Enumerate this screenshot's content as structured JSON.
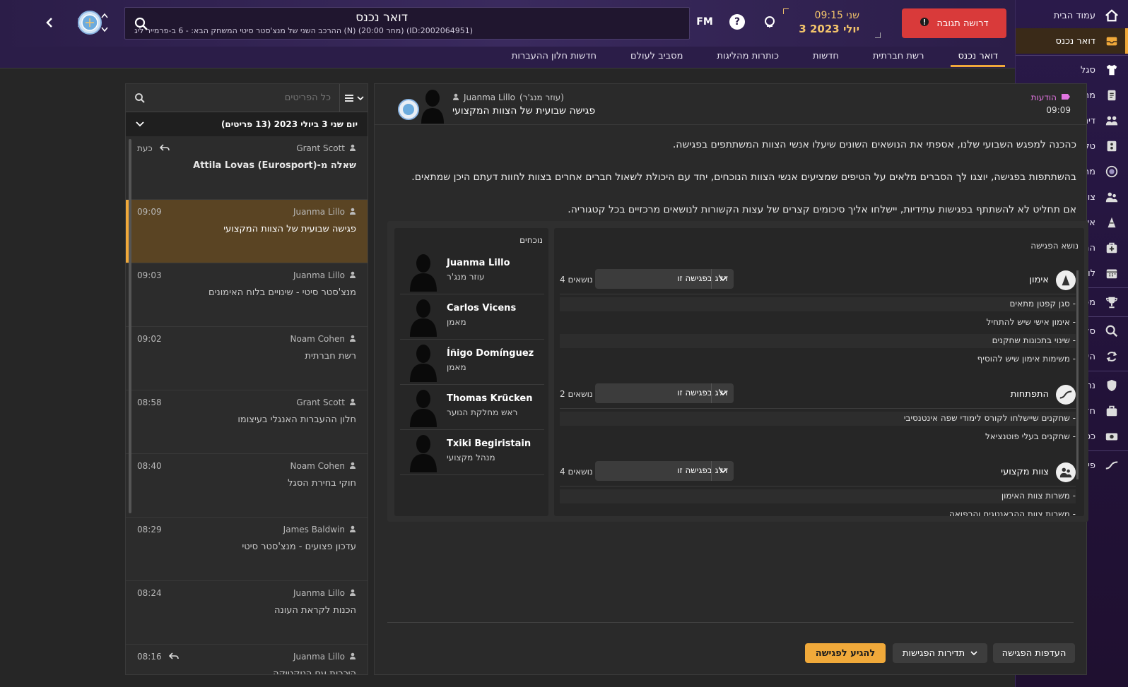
{
  "sidebar": {
    "items": [
      {
        "label": "עמוד הבית",
        "icon": "home-icon"
      },
      {
        "label": "דואר נכנס",
        "icon": "inbox-icon",
        "active": true
      },
      {
        "label": "סגל",
        "icon": "shirt-icon"
      },
      {
        "label": "מתכנן הסגל",
        "icon": "clipboard-icon"
      },
      {
        "label": "דינמיקה קבוצתית",
        "icon": "group-dynamics-icon"
      },
      {
        "label": "טקטיקה",
        "icon": "tactics-icon"
      },
      {
        "label": "מרכז הנתונים",
        "icon": "data-hub-icon"
      },
      {
        "label": "צוות מקצועי",
        "icon": "staff-icon"
      },
      {
        "label": "אימונים",
        "icon": "training-cone-icon"
      },
      {
        "label": "המרכז הרפואי",
        "icon": "medical-icon"
      },
      {
        "label": "לוח זמנים",
        "icon": "calendar-icon"
      },
      {
        "label": "מפעלים",
        "icon": "trophy-icon"
      },
      {
        "label": "סקאוטינג",
        "icon": "magnifier-icon"
      },
      {
        "label": "העברות",
        "icon": "transfers-icon"
      },
      {
        "label": "נתוני המועדון",
        "icon": "shield-icon"
      },
      {
        "label": "חזון המועדון",
        "icon": "briefcase-icon"
      },
      {
        "label": "כספים",
        "icon": "money-icon"
      },
      {
        "label": "פיתוח כשרונות",
        "icon": "development-icon"
      }
    ]
  },
  "header": {
    "title": "דואר נכנס",
    "subtitle": "ההרכב השני של מנצ'סטר סיטי המשחק הבא: - 6 ב-פרמייר ליג (N) (20:00 מחר) (ID:2002064951)",
    "fm_label": "FM",
    "time": "09:15 שני",
    "date": "3 יולי 2023",
    "response_button": "דרושה תגובה"
  },
  "tabs": [
    {
      "label": "דואר נכנס",
      "active": true
    },
    {
      "label": "רשת חברתית"
    },
    {
      "label": "חדשות"
    },
    {
      "label": "כותרות מהליגות"
    },
    {
      "label": "מסביב לעולם"
    },
    {
      "label": "חדשות חלון ההעברות"
    }
  ],
  "list": {
    "search_placeholder": "כל הפריטים",
    "group_label": "יום שני 3 ביולי 2023 (13 פריטים)",
    "messages": [
      {
        "sender": "Grant Scott",
        "time": "כעת",
        "subject": "שאלה מ-Attila Lovas (Eurosport)",
        "bold": true,
        "replied": true
      },
      {
        "sender": "Juanma Lillo",
        "time": "09:09",
        "subject": "פגישה שבועית של הצוות המקצועי",
        "selected": true
      },
      {
        "sender": "Juanma Lillo",
        "time": "09:03",
        "subject": "מנצ'סטר סיטי - שינויים בלוח האימונים"
      },
      {
        "sender": "Noam Cohen",
        "time": "09:02",
        "subject": "רשת חברתית"
      },
      {
        "sender": "Grant Scott",
        "time": "08:58",
        "subject": "חלון ההעברות האנגלי בעיצומו"
      },
      {
        "sender": "Noam Cohen",
        "time": "08:40",
        "subject": "חוקי בחירת הסגל"
      },
      {
        "sender": "James Baldwin",
        "time": "08:29",
        "subject": "עדכון פצועים - מנצ'סטר סיטי"
      },
      {
        "sender": "Juanma Lillo",
        "time": "08:24",
        "subject": "הכנות לקראת העונה"
      },
      {
        "sender": "Juanma Lillo",
        "time": "08:16",
        "subject": "היכרות עם הטקטיקה",
        "replied": true
      }
    ]
  },
  "message": {
    "category": "הודעות",
    "time": "09:09",
    "from_name": "Juanma Lillo",
    "from_role": "(עוזר מנג'ר)",
    "subject": "פגישה שבועית של הצוות המקצועי",
    "paragraphs": [
      "כהכנה למפגש השבועי שלנו, אספתי את הנושאים השונים שיעלו אנשי הצוות המשתתפים בפגישה.",
      "בהשתתפות בפגישה, יוצגו לך הסברים מלאים על הטיפים שמציעים אנשי הצוות הנוכחים, יחד עם היכולת לשאול חברים אחרים בצוות לחוות דעתם היכן שמתאים.",
      "אם תחליט לא להשתתף בפגישות עתידיות, יישלחו אליך סיכומים קצרים של עצות הקשורות לנושאים מרכזיים בכל קטגוריה."
    ],
    "attendees_title": "נוכחים",
    "attendees": [
      {
        "name": "Juanma Lillo",
        "role": "עוזר מנג'ר"
      },
      {
        "name": "Carlos Vicens",
        "role": "מאמן"
      },
      {
        "name": "Íñigo Domínguez",
        "role": "מאמן"
      },
      {
        "name": "Thomas Krücken",
        "role": "ראש מחלקת הנוער"
      },
      {
        "name": "Txiki Begiristain",
        "role": "מנהל מקצועי"
      }
    ],
    "topics_title": "נושא הפגישה",
    "topics": [
      {
        "name": "אימון",
        "count": "4 נושאים",
        "select": "דלג בפגישה זו",
        "icon": "training-cone-icon",
        "items": [
          "סגן קפטן מתאים -",
          "אימון אישי שיש להתחיל -",
          "שינוי בתכונות שחקנים -",
          "משימות אימון שיש להוסיף -"
        ]
      },
      {
        "name": "התפתחות",
        "count": "2 נושאים",
        "select": "דלג בפגישה זו",
        "icon": "development-icon",
        "items": [
          "שחקנים שיישלחו לקורס לימודי שפה אינטנסיבי -",
          "שחקנים בעלי פוטנציאל -"
        ]
      },
      {
        "name": "צוות מקצועי",
        "count": "4 נושאים",
        "select": "דלג בפגישה זו",
        "icon": "staff-icon",
        "items": [
          "משרות צוות האימון -",
          "משרות צוות ההבאנטגים והרפואה -"
        ]
      }
    ],
    "buttons": {
      "preferences": "העדפות הפגישה",
      "frequency": "תדירות הפגישות",
      "attend": "להגיע לפגישה"
    }
  }
}
